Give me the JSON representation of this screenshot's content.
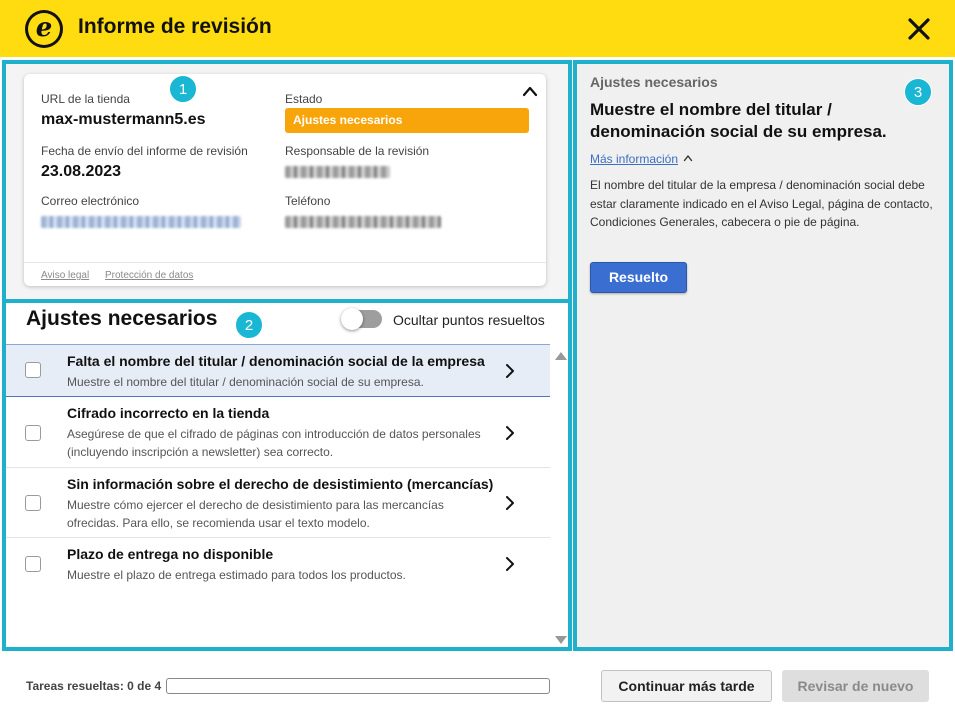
{
  "header": {
    "logo_letter": "e",
    "title": "Informe de revisión",
    "close_icon": "close-icon"
  },
  "badges": [
    "1",
    "2",
    "3"
  ],
  "card": {
    "store_url_label": "URL de la tienda",
    "store_url": "max-mustermann5.es",
    "status_label": "Estado",
    "status_value": "Ajustes necesarios",
    "status_color": "#f8a50b",
    "date_label": "Fecha de envío del informe de revisión",
    "date_value": "23.08.2023",
    "responsible_label": "Responsable de la revisión",
    "email_label": "Correo electrónico",
    "phone_label": "Teléfono",
    "footer_links": [
      "Aviso legal",
      "Protección de datos"
    ]
  },
  "adjustments": {
    "title": "Ajustes necesarios",
    "toggle_label": "Ocultar puntos resueltos",
    "items": [
      {
        "title": "Falta el nombre del titular / denominación social de la empresa",
        "desc": "Muestre el nombre del titular / denominación social de su empresa."
      },
      {
        "title": "Cifrado incorrecto en la tienda",
        "desc": "Asegúrese de que el cifrado de páginas con introducción de datos personales (incluyendo inscripción a newsletter) sea correcto."
      },
      {
        "title": "Sin información sobre el derecho de desistimiento (mercancías)",
        "desc": "Muestre cómo ejercer el derecho de desistimiento para las mercancías ofrecidas. Para ello, se recomienda usar el texto modelo."
      },
      {
        "title": "Plazo de entrega no disponible",
        "desc": "Muestre el plazo de entrega estimado para todos los productos."
      }
    ]
  },
  "detail": {
    "subtitle": "Ajustes necesarios",
    "title": "Muestre el nombre del titular / denominación social de su empresa.",
    "more_info": "Más información",
    "body": "El nombre del titular de la empresa / denominación social debe estar claramente indicado en el Aviso Legal, página de contacto, Condiciones Generales, cabecera o pie de página.",
    "resolve_button": "Resuelto"
  },
  "footer": {
    "tasks_label": "Tareas resueltas: 0 de 4",
    "progress_fraction": 0,
    "continue_later": "Continuar más tarde",
    "review_again": "Revisar de nuevo"
  },
  "colors": {
    "brand_yellow": "#ffdc0f",
    "frame_teal": "#1fb1cc",
    "primary_blue": "#3a6fd1"
  }
}
